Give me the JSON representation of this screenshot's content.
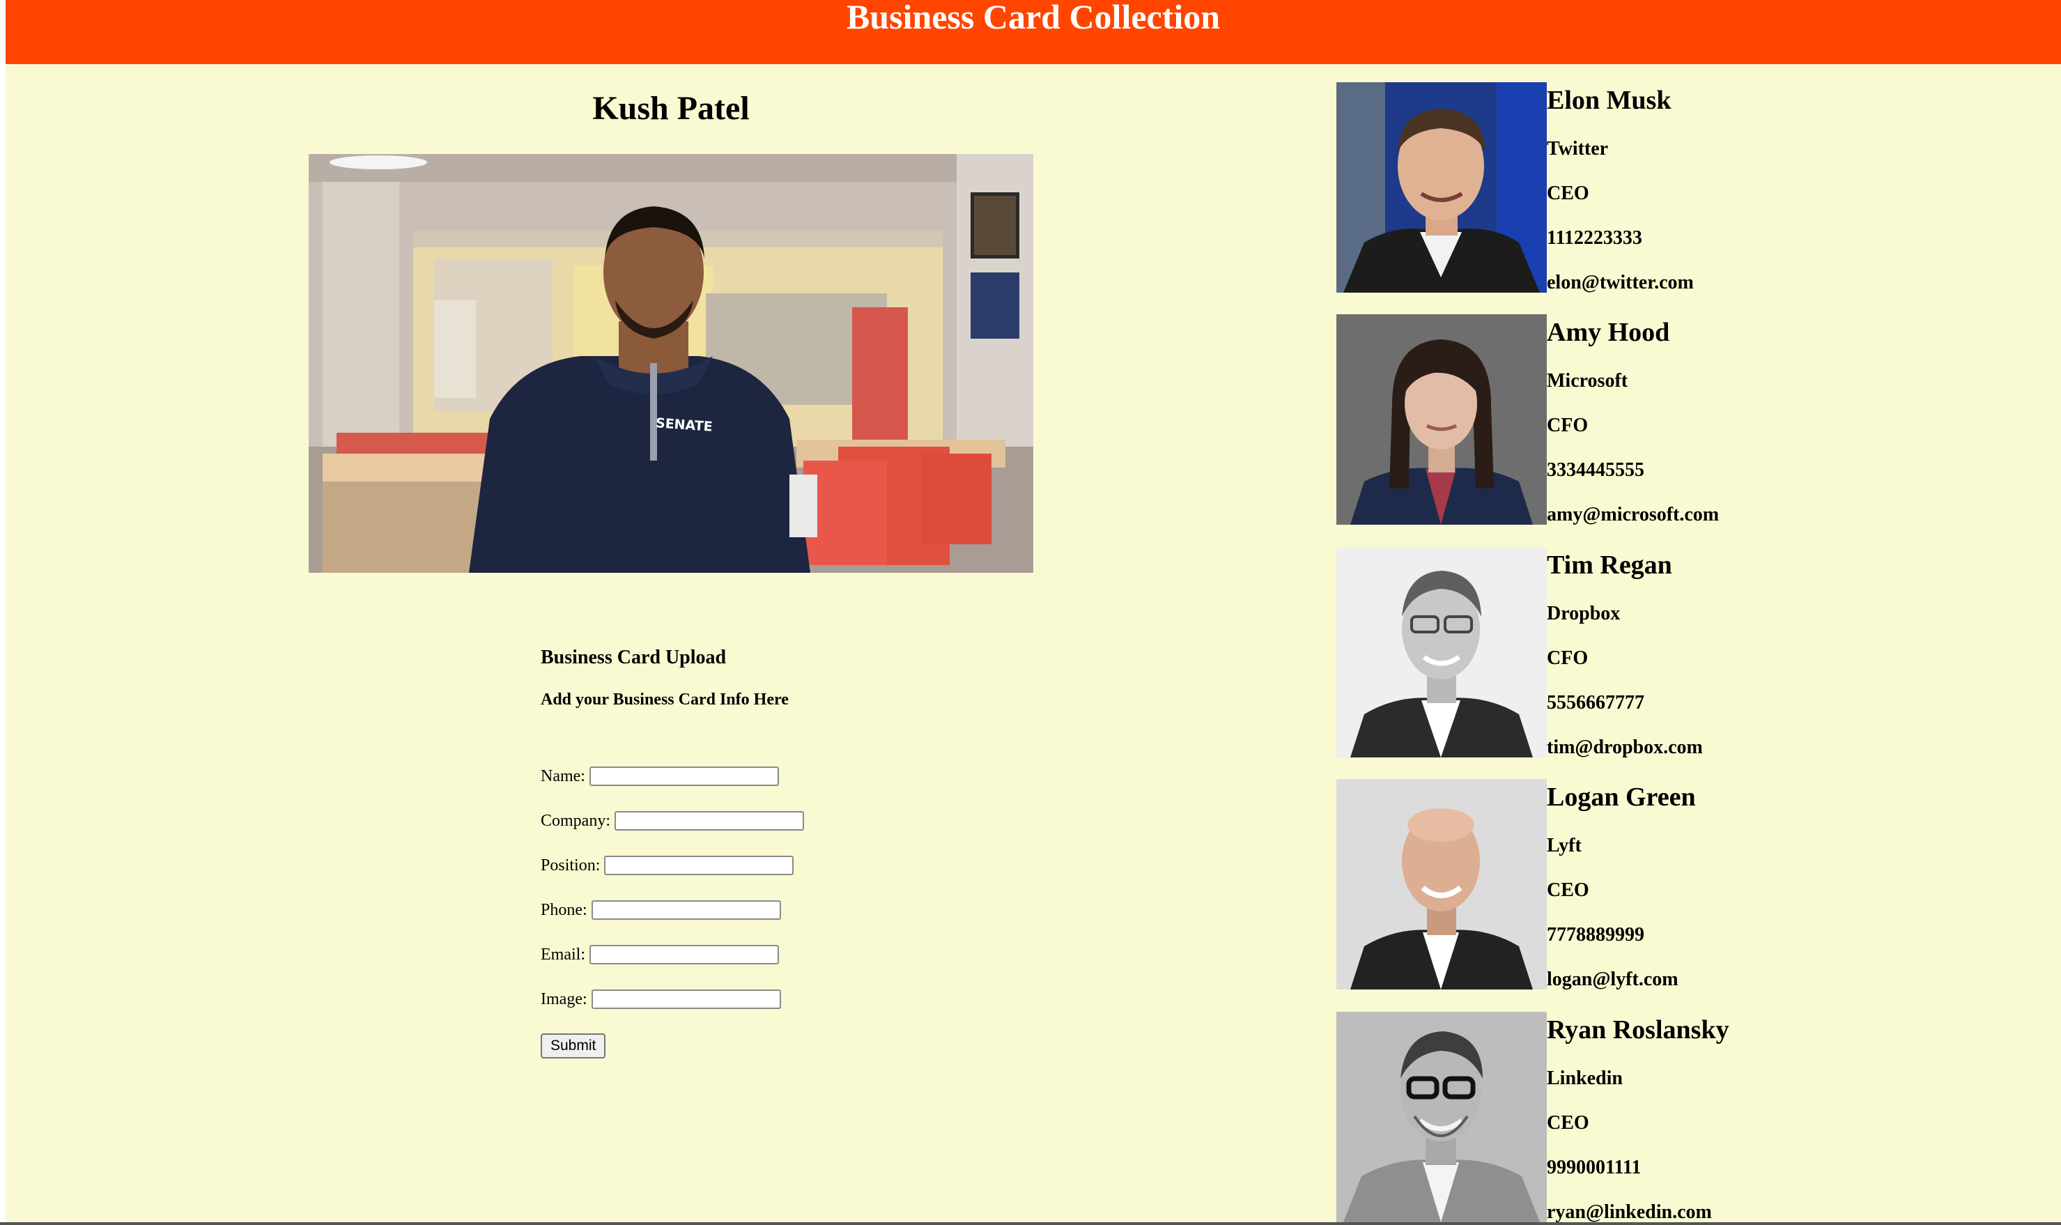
{
  "header": {
    "title": "Business Card Collection"
  },
  "profile": {
    "name": "Kush Patel",
    "sweatshirt_text": "SENATE"
  },
  "upload": {
    "title": "Business Card Upload",
    "subtitle": "Add your Business Card Info Here",
    "fields": [
      {
        "label": "Name:",
        "value": ""
      },
      {
        "label": "Company:",
        "value": ""
      },
      {
        "label": "Position:",
        "value": ""
      },
      {
        "label": "Phone:",
        "value": ""
      },
      {
        "label": "Email:",
        "value": ""
      },
      {
        "label": "Image:",
        "value": ""
      }
    ],
    "submit_label": "Submit"
  },
  "cards": [
    {
      "name": "Elon Musk",
      "company": "Twitter",
      "position": "CEO",
      "phone": "1112223333",
      "email": "elon@twitter.com"
    },
    {
      "name": "Amy Hood",
      "company": "Microsoft",
      "position": "CFO",
      "phone": "3334445555",
      "email": "amy@microsoft.com"
    },
    {
      "name": "Tim Regan",
      "company": "Dropbox",
      "position": "CFO",
      "phone": "5556667777",
      "email": "tim@dropbox.com"
    },
    {
      "name": "Logan Green",
      "company": "Lyft",
      "position": "CEO",
      "phone": "7778889999",
      "email": "logan@lyft.com"
    },
    {
      "name": "Ryan Roslansky",
      "company": "Linkedin",
      "position": "CEO",
      "phone": "9990001111",
      "email": "ryan@linkedin.com"
    }
  ],
  "colors": {
    "header": "#ff4500",
    "background": "#fafad2"
  }
}
